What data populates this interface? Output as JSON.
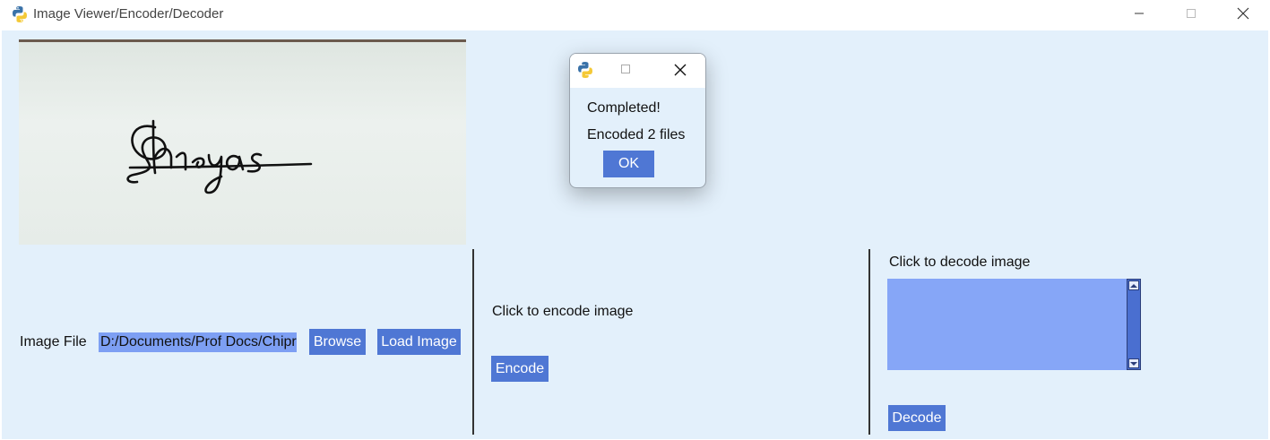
{
  "window": {
    "title": "Image Viewer/Encoder/Decoder",
    "controls": {
      "minimize": "—",
      "maximize": "□",
      "close": "✕"
    }
  },
  "preview": {
    "signature_text": "Shreyas"
  },
  "file_section": {
    "label": "Image File",
    "path_value": "D:/Documents/Prof Docs/Chipr",
    "browse_label": "Browse",
    "load_label": "Load Image"
  },
  "encode_section": {
    "label": "Click to encode image",
    "button_label": "Encode"
  },
  "decode_section": {
    "label": "Click to decode image",
    "output_text": "",
    "button_label": "Decode"
  },
  "dialog": {
    "message_line1": "Completed!",
    "message_line2": "Encoded 2 files",
    "ok_label": "OK"
  },
  "colors": {
    "background": "#e3f0fb",
    "button": "#4f77d4",
    "textbox": "#86a6f7",
    "selection": "#7d9ff3"
  }
}
